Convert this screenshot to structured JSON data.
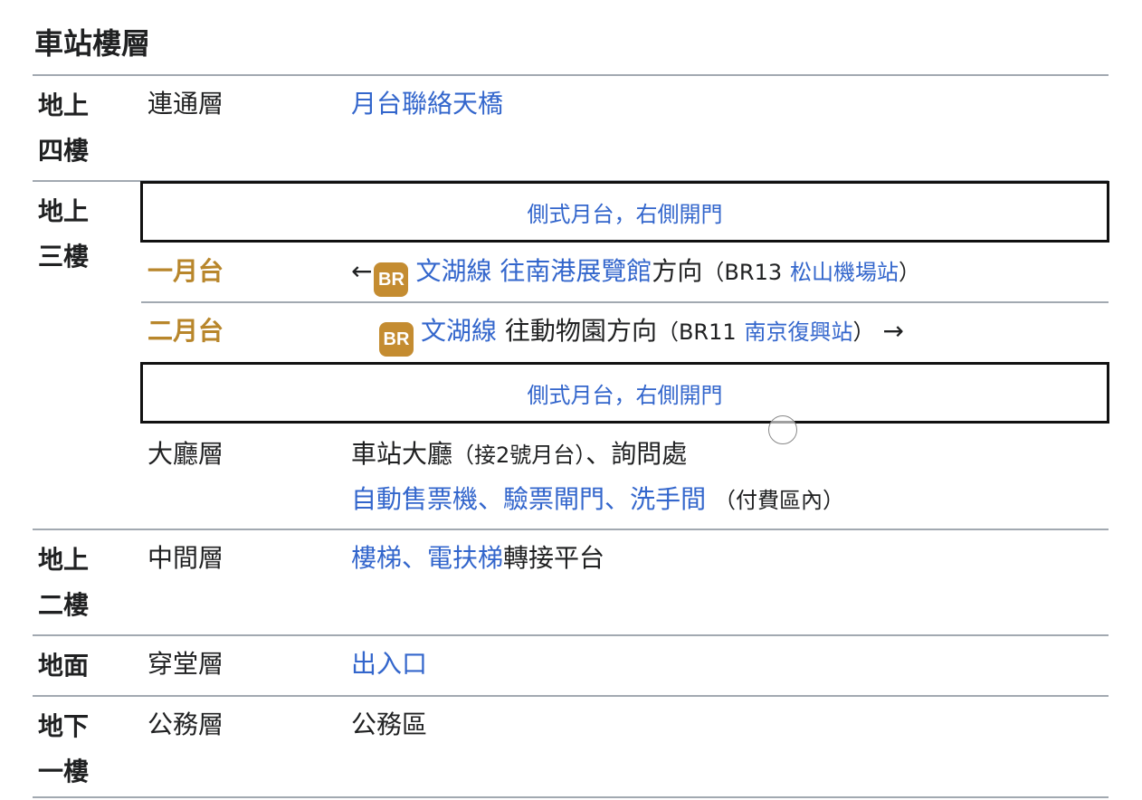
{
  "title": "車站樓層",
  "floors": {
    "f4": {
      "name_line1": "地上",
      "name_line2": "四樓",
      "level": "連通層",
      "desc": "月台聯絡天橋"
    },
    "f3": {
      "name_line1": "地上",
      "name_line2": "三樓",
      "side_platform_top": "側式月台，右側開門",
      "platform1": {
        "label": "一月台",
        "arrow_left": "←",
        "badge": "BR",
        "line": "文湖線",
        "towards": "往南港展覽館",
        "direction": "方向",
        "paren_open": "（",
        "code": "BR13",
        "next_station": "松山機場站",
        "paren_close": "）"
      },
      "platform2": {
        "label": "二月台",
        "badge": "BR",
        "line": "文湖線",
        "towards": "往動物園",
        "direction": "方向",
        "paren_open": "（",
        "code": "BR11",
        "next_station": "南京復興站",
        "paren_close": "）",
        "arrow_right": "→"
      },
      "side_platform_bottom": "側式月台，右側開門",
      "concourse": {
        "level": "大廳層",
        "line1_a": "車站大廳",
        "line1_paren": "（接2號月台）",
        "line1_b": "、詢問處",
        "line2_a": "自動售票機",
        "sep1": "、",
        "line2_b": "驗票閘門",
        "sep2": "、",
        "line2_c": "洗手間",
        "line2_paren": "（付費區內）"
      }
    },
    "f2": {
      "name_line1": "地上",
      "name_line2": "二樓",
      "level": "中間層",
      "desc_link": "樓梯、電扶梯",
      "desc_rest": "轉接平台"
    },
    "g": {
      "name": "地面",
      "level": "穿堂層",
      "desc": "出入口"
    },
    "b1": {
      "name_line1": "地下",
      "name_line2": "一樓",
      "level": "公務層",
      "desc": "公務區"
    }
  },
  "colors": {
    "link": "#3366cc",
    "platform_label": "#b8862b",
    "badge": "#c48c31",
    "rule": "#a2a9b1"
  }
}
